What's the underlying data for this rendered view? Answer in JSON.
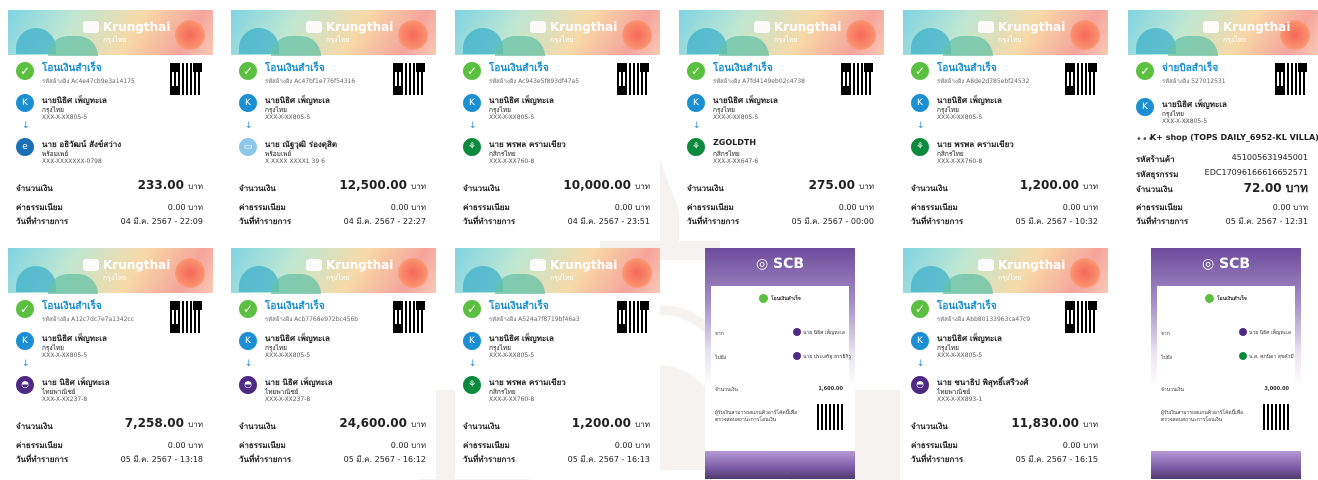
{
  "ktb": {
    "brand": "Krungthai",
    "brand_sub": "กรุงไทย",
    "labels": {
      "amount": "จำนวนเงิน",
      "fee": "ค่าธรรมเนียม",
      "date": "วันที่ทำรายการ",
      "currency": "บาท"
    }
  },
  "slips": [
    {
      "title": "โอนเงินสำเร็จ",
      "ref": "รหัสอ้างอิง Ac4e47cb9e3a14175",
      "from": {
        "name": "นายนิธิศ เพ็ญทะเล",
        "bank": "กรุงไทย",
        "account": "XXX-X-XX805-5"
      },
      "to": {
        "name": "นาย อธิวัฒน์ สังข์สว่าง",
        "bank": "พร้อมเพย์",
        "account": "XXX-XXXXXXX-0798"
      },
      "amount": "233.00",
      "fee": "0.00 บาท",
      "date": "04 มี.ค. 2567 - 22:09"
    },
    {
      "title": "โอนเงินสำเร็จ",
      "ref": "รหัสอ้างอิง Ac47bf1e776f54316",
      "from": {
        "name": "นายนิธิศ เพ็ญทะเล",
        "bank": "กรุงไทย",
        "account": "XXX-X-XX805-5"
      },
      "to": {
        "name": "นาย ณัฐวุฒิ ร่องดุสิต",
        "bank": "พร้อมเพย์",
        "account": "X XXXX XXXX1 39 6"
      },
      "amount": "12,500.00",
      "fee": "0.00 บาท",
      "date": "04 มี.ค. 2567 - 22:27"
    },
    {
      "title": "โอนเงินสำเร็จ",
      "ref": "รหัสอ้างอิง Ac943e5f893df47a5",
      "from": {
        "name": "นายนิธิศ เพ็ญทะเล",
        "bank": "กรุงไทย",
        "account": "XXX-X-XX805-5"
      },
      "to": {
        "name": "นาย พรพล ครามเขียว",
        "bank": "กสิกรไทย",
        "account": "XXX-X-XX760-8"
      },
      "amount": "10,000.00",
      "fee": "0.00 บาท",
      "date": "04 มี.ค. 2567 - 23:51"
    },
    {
      "title": "โอนเงินสำเร็จ",
      "ref": "รหัสอ้างอิง A7fd4149eb02c4738",
      "from": {
        "name": "นายนิธิศ เพ็ญทะเล",
        "bank": "กรุงไทย",
        "account": "XXX-X-XX805-5"
      },
      "to": {
        "name": "ZGOLDTH",
        "bank": "กสิกรไทย",
        "account": "XXX-X-XX647-6"
      },
      "amount": "275.00",
      "fee": "0.00 บาท",
      "date": "05 มี.ค. 2567 - 00:00"
    },
    {
      "title": "โอนเงินสำเร็จ",
      "ref": "รหัสอ้างอิง A8de2d785ebf24532",
      "from": {
        "name": "นายนิธิศ เพ็ญทะเล",
        "bank": "กรุงไทย",
        "account": "XXX-X-XX805-5"
      },
      "to": {
        "name": "นาย พรพล ครามเขียว",
        "bank": "กสิกรไทย",
        "account": "XXX-X-XX760-8"
      },
      "amount": "1,200.00",
      "fee": "0.00 บาท",
      "date": "05 มี.ค. 2567 - 10:32"
    },
    {
      "title": "โอนเงินสำเร็จ",
      "ref": "รหัสอ้างอิง A12c7dc7e7a1342cc",
      "from": {
        "name": "นายนิธิศ เพ็ญทะเล",
        "bank": "กรุงไทย",
        "account": "XXX-X-XX805-5"
      },
      "to": {
        "name": "นาย นิธิศ เพ็ญทะเล",
        "bank": "ไทยพาณิชย์",
        "account": "XXX-X-XX237-8"
      },
      "amount": "7,258.00",
      "fee": "0.00 บาท",
      "date": "05 มี.ค. 2567 - 13:18"
    },
    {
      "title": "โอนเงินสำเร็จ",
      "ref": "รหัสอ้างอิง Acb7768e972bc456b",
      "from": {
        "name": "นายนิธิศ เพ็ญทะเล",
        "bank": "กรุงไทย",
        "account": "XXX-X-XX805-5"
      },
      "to": {
        "name": "นาย นิธิศ เพ็ญทะเล",
        "bank": "ไทยพาณิชย์",
        "account": "XXX-X-XX237-8"
      },
      "amount": "24,600.00",
      "fee": "0.00 บาท",
      "date": "05 มี.ค. 2567 - 16:12"
    },
    {
      "title": "โอนเงินสำเร็จ",
      "ref": "รหัสอ้างอิง A524a7f8719bf46a3",
      "from": {
        "name": "นายนิธิศ เพ็ญทะเล",
        "bank": "กรุงไทย",
        "account": "XXX-X-XX805-5"
      },
      "to": {
        "name": "นาย พรพล ครามเขียว",
        "bank": "กสิกรไทย",
        "account": "XXX-X-XX760-8"
      },
      "amount": "1,200.00",
      "fee": "0.00 บาท",
      "date": "05 มี.ค. 2567 - 16:13"
    },
    {
      "title": "โอนเงินสำเร็จ",
      "ref": "รหัสอ้างอิง Abb80133963ca47c9",
      "from": {
        "name": "นายนิธิศ เพ็ญทะเล",
        "bank": "กรุงไทย",
        "account": "XXX-X-XX805-5"
      },
      "to": {
        "name": "นาย ชนาธิป พิสุทธิ์เสรีวงศ์",
        "bank": "ไทยพาณิชย์",
        "account": "XXX-X-XX893-1"
      },
      "amount": "11,830.00",
      "fee": "0.00 บาท",
      "date": "05 มี.ค. 2567 - 16:15"
    }
  ],
  "bill": {
    "title": "จ่ายบิลสำเร็จ",
    "ref": "รหัสอ้างอิง 527012531",
    "from": {
      "name": "นายนิธิศ เพ็ญทะเล",
      "bank": "กรุงไทย",
      "account": "XXX-X-XX805-5"
    },
    "merchant": "K+ shop (TOPS DAILY_6952-KL VILLA)",
    "rows": [
      {
        "label": "รหัสร้านค้า",
        "value": "451005631945001"
      },
      {
        "label": "รหัสธุรกรรม",
        "value": "EDC17096166616652571"
      },
      {
        "label": "จำนวนเงิน",
        "value": "72.00 บาท"
      },
      {
        "label": "ค่าธรรมเนียม",
        "value": "0.00 บาท"
      },
      {
        "label": "วันที่ทำรายการ",
        "value": "05 มี.ค. 2567 - 12:31"
      }
    ]
  },
  "scb": [
    {
      "brand": "SCB",
      "status": "โอนเงินสำเร็จ",
      "from_label": "จาก",
      "to_label": "ไปยัง",
      "from_name": "นาย นิธิศ เพ็ญทะเล",
      "to_name": "นาย ประเสริฐ ยรรยิกิรู",
      "amount_label": "จำนวนเงิน",
      "amount": "1,600.00",
      "note": "ผู้รับเงินสามารถสแกนคิวอาร์โค้ดนี้เพื่อตรวจสอบสถานะการโอนเงิน"
    },
    {
      "brand": "SCB",
      "status": "โอนเงินสำเร็จ",
      "from_label": "จาก",
      "to_label": "ไปยัง",
      "from_name": "นาย นิธิศ เพ็ญทะเล",
      "to_name": "น.ส. ศุภนิดา สุขคำมี",
      "amount_label": "จำนวนเงิน",
      "amount": "3,000.00",
      "note": "ผู้รับเงินสามารถสแกนคิวอาร์โค้ดนี้เพื่อตรวจสอบสถานะการโอนเงิน"
    }
  ],
  "colors": {
    "ktb_blue": "#1b8fd1",
    "success_green": "#5bbf3f",
    "kbank_green": "#0b8a3e",
    "scb_purple": "#4e2a84",
    "promptpay_blue": "#1a6fb5"
  }
}
